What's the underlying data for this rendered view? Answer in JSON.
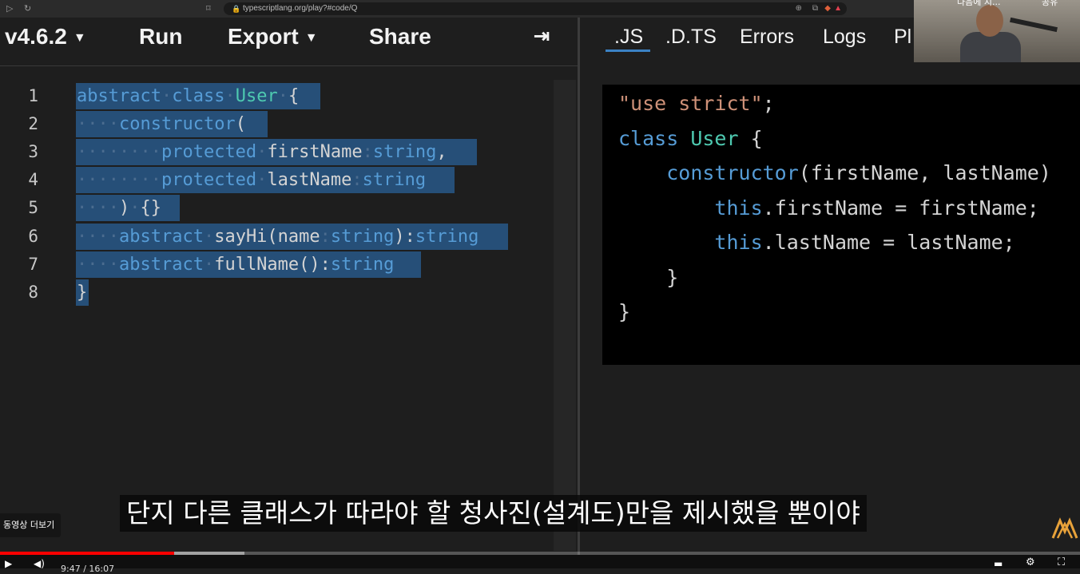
{
  "browser": {
    "url": "typescriptlang.org/play?#code/Q"
  },
  "toolbar": {
    "version_label": "v4.6.2",
    "run_label": "Run",
    "export_label": "Export",
    "share_label": "Share",
    "collapse_icon": "arrow-to-right-icon",
    "dropdown_icon": "caret-down-icon"
  },
  "output_tabs": [
    ".JS",
    ".D.TS",
    "Errors",
    "Logs",
    "Pl"
  ],
  "active_tab": ".JS",
  "editor": {
    "line_numbers": [
      "1",
      "2",
      "3",
      "4",
      "5",
      "6",
      "7",
      "8"
    ],
    "lines": [
      [
        [
          "kw",
          "abstract"
        ],
        [
          "ws",
          "·"
        ],
        [
          "kw",
          "class"
        ],
        [
          "ws",
          "·"
        ],
        [
          "cls",
          "User"
        ],
        [
          "ws",
          "·"
        ],
        [
          "id",
          "{"
        ]
      ],
      [
        [
          "ws",
          "····"
        ],
        [
          "kw",
          "constructor"
        ],
        [
          "id",
          "("
        ]
      ],
      [
        [
          "ws",
          "········"
        ],
        [
          "kw",
          "protected"
        ],
        [
          "ws",
          "·"
        ],
        [
          "id",
          "firstName"
        ],
        [
          "ws",
          ":"
        ],
        [
          "kw",
          "string"
        ],
        [
          "id",
          ","
        ]
      ],
      [
        [
          "ws",
          "········"
        ],
        [
          "kw",
          "protected"
        ],
        [
          "ws",
          "·"
        ],
        [
          "id",
          "lastName"
        ],
        [
          "ws",
          ":"
        ],
        [
          "kw",
          "string"
        ]
      ],
      [
        [
          "ws",
          "····"
        ],
        [
          "id",
          ")"
        ],
        [
          "ws",
          "·"
        ],
        [
          "id",
          "{}"
        ]
      ],
      [
        [
          "ws",
          "····"
        ],
        [
          "kw",
          "abstract"
        ],
        [
          "ws",
          "·"
        ],
        [
          "id",
          "sayHi(name"
        ],
        [
          "ws",
          ":"
        ],
        [
          "kw",
          "string"
        ],
        [
          "id",
          "):"
        ],
        [
          "kw",
          "string"
        ]
      ],
      [
        [
          "ws",
          "····"
        ],
        [
          "kw",
          "abstract"
        ],
        [
          "ws",
          "·"
        ],
        [
          "id",
          "fullName():"
        ],
        [
          "kw",
          "string"
        ]
      ],
      [
        [
          "id",
          "}"
        ]
      ]
    ]
  },
  "output": {
    "lines": [
      [
        [
          "str",
          "\"use strict\""
        ],
        [
          "id",
          ";"
        ]
      ],
      [
        [
          "kw",
          "class"
        ],
        [
          "id",
          " "
        ],
        [
          "cls",
          "User"
        ],
        [
          "id",
          " {"
        ]
      ],
      [
        [
          "id",
          "    "
        ],
        [
          "kw",
          "constructor"
        ],
        [
          "id",
          "(firstName, lastName)"
        ]
      ],
      [
        [
          "id",
          "        "
        ],
        [
          "kw",
          "this"
        ],
        [
          "id",
          ".firstName = firstName;"
        ]
      ],
      [
        [
          "id",
          "        "
        ],
        [
          "kw",
          "this"
        ],
        [
          "id",
          ".lastName = lastName;"
        ]
      ],
      [
        [
          "id",
          "    }"
        ]
      ],
      [
        [
          "id",
          "}"
        ]
      ]
    ]
  },
  "webcam": {
    "overlay_text": "다음에 지...",
    "overlay_text_right": "공유"
  },
  "subtitle": "단지 다른 클래스가 따라야 할 청사진(설계도)만을 제시했을 뿐이야",
  "more_videos_label": "동영상 더보기",
  "player": {
    "time": "9:47 / 16:07",
    "progress_fraction": 0.161,
    "buffer_fraction": 0.226
  },
  "colors": {
    "keyword": "#569cd6",
    "class_name": "#4ec9b0",
    "string": "#ce9178",
    "selection": "#264f78",
    "accent": "#3b82c4",
    "progress": "#ff0000"
  }
}
